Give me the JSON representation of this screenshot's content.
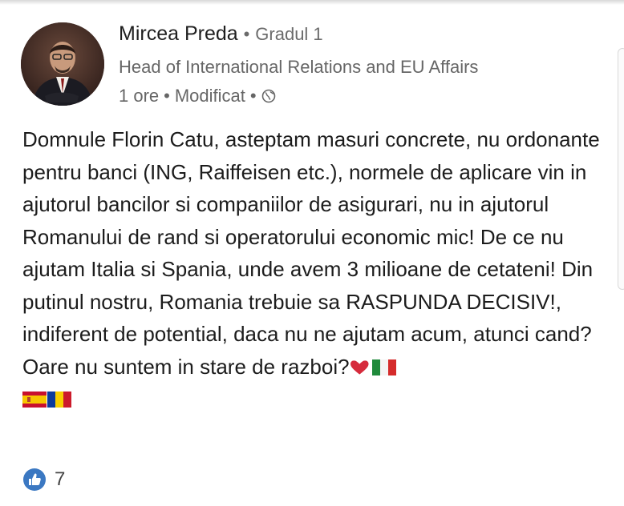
{
  "author": {
    "name": "Mircea Preda",
    "separator": "•",
    "degree": "Gradul 1",
    "headline": "Head of International Relations and EU Affairs"
  },
  "meta": {
    "time": "1 ore",
    "separator": "•",
    "edited": "Modificat",
    "separator2": "•",
    "visibility_icon": "globe-icon"
  },
  "post": {
    "text": "Domnule Florin Catu, asteptam masuri concrete, nu ordonante pentru banci (ING, Raiffeisen etc.), normele de aplicare vin in ajutorul bancilor si companiilor de asigurari, nu in ajutorul Romanului de rand si operatorului economic mic! De ce nu ajutam Italia si Spania, unde avem 3 milioane de cetateni! Din putinul nostru, Romania trebuie sa RASPUNDA DECISIV!, indiferent de potential, daca nu ne ajutam acum, atunci cand?  Oare nu suntem in stare de razboi?",
    "emojis": [
      "red-heart",
      "flag-italy",
      "flag-spain",
      "flag-romania"
    ]
  },
  "reactions": {
    "icon": "like-icon",
    "count": "7"
  },
  "colors": {
    "like_blue": "#3b78c2",
    "heart_red": "#d62b3c",
    "meta_gray": "#666666"
  }
}
